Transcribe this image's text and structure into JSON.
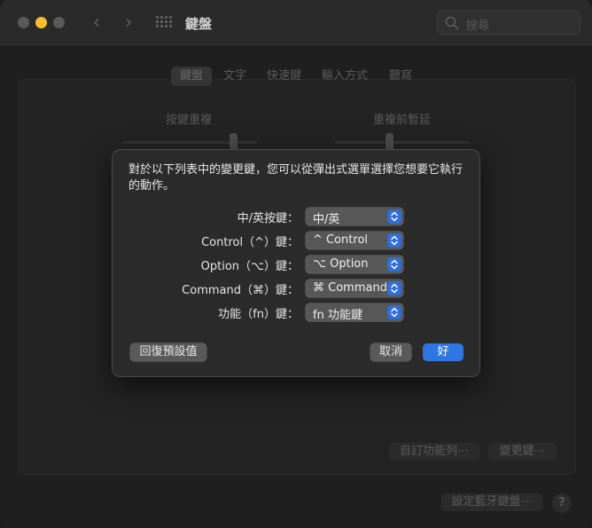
{
  "window": {
    "title": "鍵盤",
    "search_placeholder": "搜尋",
    "traffic_lights": {
      "close": "#5a5a5c",
      "minimize": "#febc2e",
      "zoom": "#5a5a5c"
    }
  },
  "tabs": [
    {
      "label": "鍵盤",
      "active": true
    },
    {
      "label": "文字",
      "active": false
    },
    {
      "label": "快速鍵",
      "active": false
    },
    {
      "label": "輸入方式",
      "active": false
    },
    {
      "label": "聽寫",
      "active": false
    }
  ],
  "sliders": [
    {
      "label": "按鍵重複"
    },
    {
      "label": "重複前暫延"
    }
  ],
  "bottom_buttons": {
    "touch_bar": "自訂功能列⋯",
    "modifier_keys": "變更鍵⋯",
    "bluetooth": "設定藍牙鍵盤⋯",
    "help": "?"
  },
  "sheet": {
    "message": "對於以下列表中的變更鍵，您可以從彈出式選單選擇您想要它執行的動作。",
    "rows": [
      {
        "label": "中/英按鍵：",
        "value": "中/英"
      },
      {
        "label": "Control（^）鍵：",
        "value": "^ Control"
      },
      {
        "label": "Option（⌥）鍵：",
        "value": "⌥ Option"
      },
      {
        "label": "Command（⌘）鍵：",
        "value": "⌘ Command"
      },
      {
        "label": "功能（fn）鍵：",
        "value": "fn 功能鍵"
      }
    ],
    "restore_defaults": "回復預設值",
    "cancel": "取消",
    "ok": "好",
    "accent_color": "#2f76e3"
  }
}
